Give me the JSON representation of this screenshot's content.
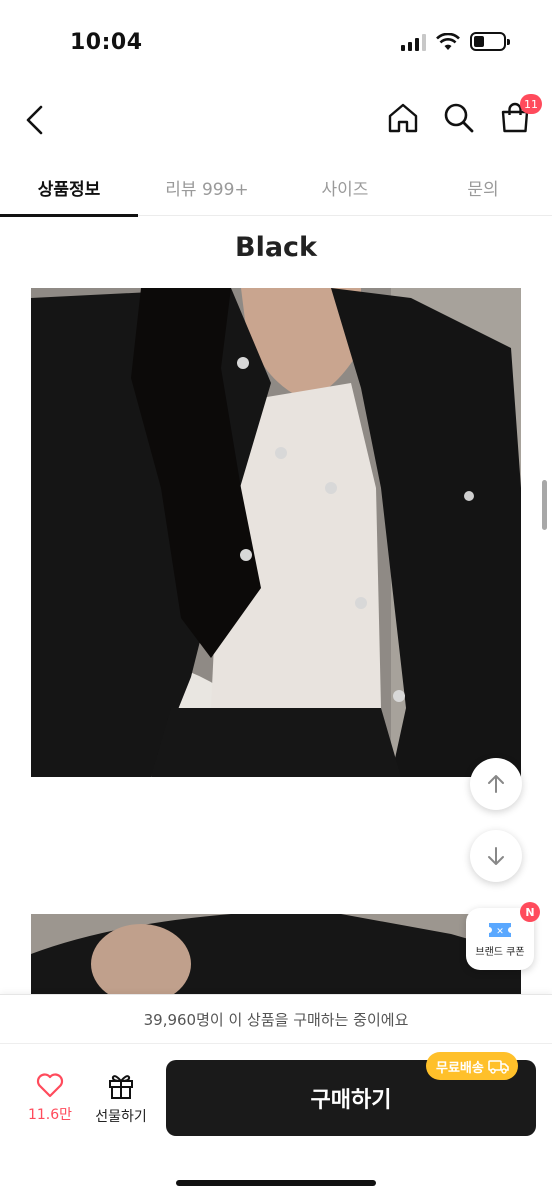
{
  "status_bar": {
    "time": "10:04",
    "icons": [
      "cellular-signal-icon",
      "wifi-icon",
      "battery-icon"
    ]
  },
  "top_nav": {
    "back_icon": "chevron-left-icon",
    "home_icon": "home-icon",
    "search_icon": "search-icon",
    "cart_icon": "shopping-bag-icon",
    "cart_badge": "11"
  },
  "tabs": [
    {
      "label": "상품정보",
      "active": true
    },
    {
      "label": "리뷰 999+",
      "active": false
    },
    {
      "label": "사이즈",
      "active": false
    },
    {
      "label": "문의",
      "active": false
    }
  ],
  "content": {
    "section_title": "Black",
    "images": [
      "product-photo-black-jacket",
      "product-photo-black-jacket-2"
    ]
  },
  "floating": {
    "up_icon": "arrow-up-icon",
    "down_icon": "arrow-down-icon",
    "coupon_label": "브랜드 쿠폰",
    "coupon_badge": "N"
  },
  "purchase_notice": "39,960명이 이 상품을 구매하는 중이에요",
  "bottom_bar": {
    "like_count": "11.6만",
    "gift_label": "선물하기",
    "buy_label": "구매하기",
    "free_shipping_label": "무료배송"
  },
  "colors": {
    "accent_red": "#ff4b5c",
    "buy_button": "#1a1a1a",
    "free_shipping": "#ffc02a"
  }
}
